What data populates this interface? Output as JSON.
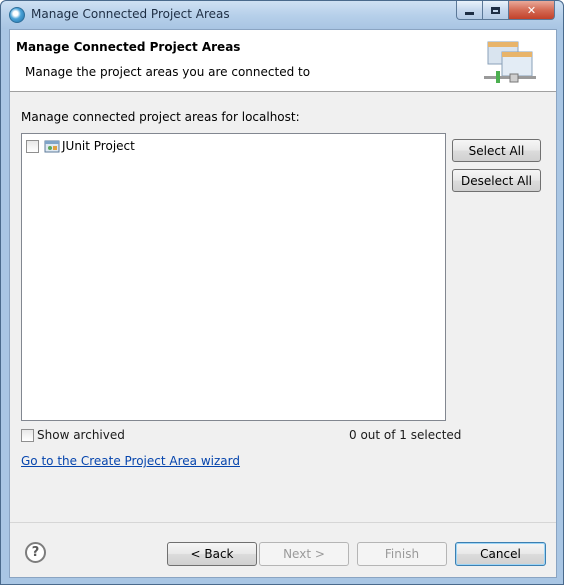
{
  "window": {
    "title": "Manage Connected Project Areas"
  },
  "header": {
    "title": "Manage Connected Project Areas",
    "description": "Manage the project areas you are connected to"
  },
  "section": {
    "label": "Manage connected project areas for localhost:"
  },
  "project_list": {
    "items": [
      {
        "label": "JUnit Project",
        "checked": false,
        "icon": "project-area-icon"
      }
    ]
  },
  "side_buttons": {
    "select_all": "Select All",
    "deselect_all": "Deselect All"
  },
  "options": {
    "show_archived_label": "Show archived",
    "show_archived_checked": false,
    "selection_count": "0 out of 1 selected"
  },
  "link": {
    "create_wizard": "Go to the Create Project Area wizard"
  },
  "footer": {
    "help_icon": "help-icon",
    "back": "< Back",
    "next": "Next >",
    "finish": "Finish",
    "cancel": "Cancel"
  }
}
